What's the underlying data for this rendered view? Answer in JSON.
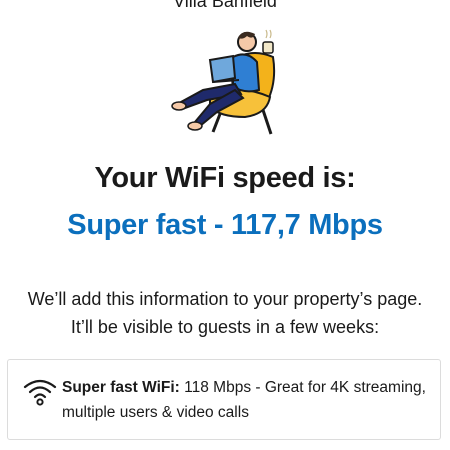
{
  "header": {
    "property_name": "Villa Banfield"
  },
  "illustration": {
    "icon": "person-on-laptop-in-armchair-illustration"
  },
  "result": {
    "title": "Your WiFi speed is:",
    "speed_text": "Super fast - 117,7 Mbps",
    "speed_color": "#0b6fbd"
  },
  "info": {
    "line1": "We’ll add this information to your property’s page.",
    "line2": "It’ll be visible to guests in a few weeks:"
  },
  "card": {
    "icon": "wifi-icon",
    "label": "Super fast WiFi:",
    "description": " 118 Mbps - Great for 4K streaming, multiple users & video calls"
  }
}
